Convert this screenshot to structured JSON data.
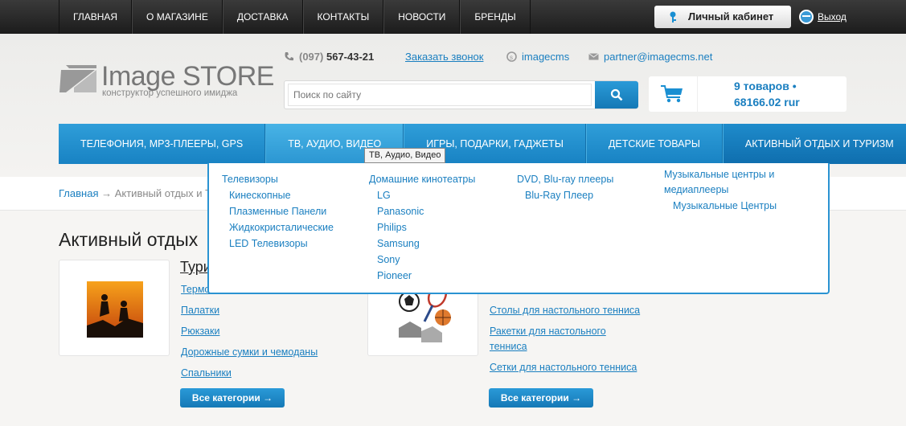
{
  "topnav": {
    "items": [
      "ГЛАВНАЯ",
      "О МАГАЗИНЕ",
      "ДОСТАВКА",
      "КОНТАКТЫ",
      "НОВОСТИ",
      "БРЕНДЫ"
    ],
    "cabinet": "Личный кабинет",
    "logout": "Выход"
  },
  "logo": {
    "main": "Image STORE",
    "tagline": "конструктор успешного имиджа"
  },
  "contacts": {
    "phone_code": "(097)",
    "phone_number": "567-43-21",
    "callback": "Заказать звонок",
    "skype": "imagecms",
    "email": "partner@imagecms.net"
  },
  "search": {
    "placeholder": "Поиск по сайту"
  },
  "cart": {
    "count": "9 товаров •",
    "sum": "68166.02 rur"
  },
  "mainnav": [
    "ТЕЛЕФОНИЯ, MP3-ПЛЕЕРЫ, GPS",
    "ТВ, АУДИО, ВИДЕО",
    "ИГРЫ, ПОДАРКИ, ГАДЖЕТЫ",
    "ДЕТСКИЕ ТОВАРЫ",
    "АКТИВНЫЙ ОТДЫХ И ТУРИЗМ"
  ],
  "tooltip": "ТВ, Аудио, Видео",
  "dropdown": {
    "col1": {
      "head": "Телевизоры",
      "items": [
        "Кинескопные",
        "Плазменные Панели",
        "Жидкокристалические",
        "LED Телевизоры"
      ]
    },
    "col2": {
      "head": "Домашние кинотеатры",
      "items": [
        "LG",
        "Panasonic",
        "Philips",
        "Samsung",
        "Sony",
        "Pioneer"
      ]
    },
    "col3": {
      "head": "DVD, Blu-ray плееры",
      "items": [
        "Blu-Ray Плеер"
      ]
    },
    "col4": {
      "head1": "Музыкальные центры и",
      "head2": "медиаплееры",
      "items": [
        "Музыкальные Центры"
      ]
    }
  },
  "breadcrumb": {
    "home": "Главная",
    "current": "→ Активный отдых и Т"
  },
  "page_title": "Активный отдых",
  "category1": {
    "title": "Тури",
    "links": [
      "Термо",
      "Палатки",
      "Рюкзаки",
      "Дорожные сумки и чемоданы",
      "Спальники"
    ],
    "button": "Все категории →"
  },
  "category2": {
    "links": [
      "Столы для настольного тенниса",
      "Ракетки для настольного",
      "тенниса",
      "Сетки для настольного тенниса"
    ],
    "button": "Все категории →"
  },
  "colors": {
    "accent": "#1a7fc0",
    "nav_blue": "#1882c3",
    "topbar": "#1c1c1c"
  }
}
